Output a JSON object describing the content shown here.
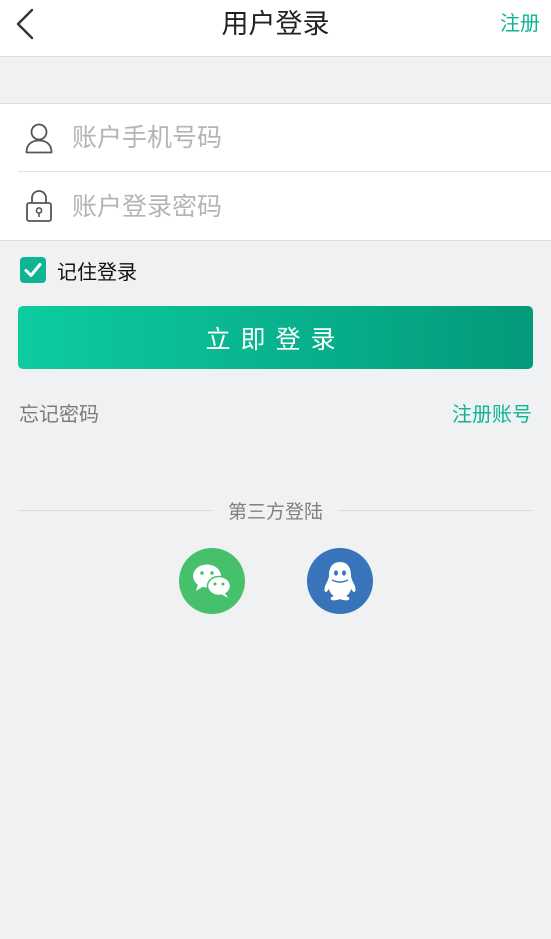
{
  "nav": {
    "title": "用户登录",
    "right_label": "注册",
    "back_icon": "chevron-left-icon"
  },
  "form": {
    "phone": {
      "placeholder": "账户手机号码",
      "value": "",
      "icon": "user-icon"
    },
    "password": {
      "placeholder": "账户登录密码",
      "value": "",
      "icon": "lock-icon"
    }
  },
  "remember": {
    "label": "记住登录",
    "checked": true
  },
  "login_button": {
    "label": "立即登录"
  },
  "links": {
    "forgot": "忘记密码",
    "register": "注册账号"
  },
  "third_party": {
    "label": "第三方登陆",
    "providers": [
      {
        "name": "wechat-icon",
        "color": "#46c06b"
      },
      {
        "name": "qq-icon",
        "color": "#3874b9"
      }
    ]
  },
  "colors": {
    "accent": "#0fb592",
    "accent_gradient_start": "#0dcca0",
    "accent_gradient_end": "#039a7a",
    "background": "#f0f1f3"
  }
}
